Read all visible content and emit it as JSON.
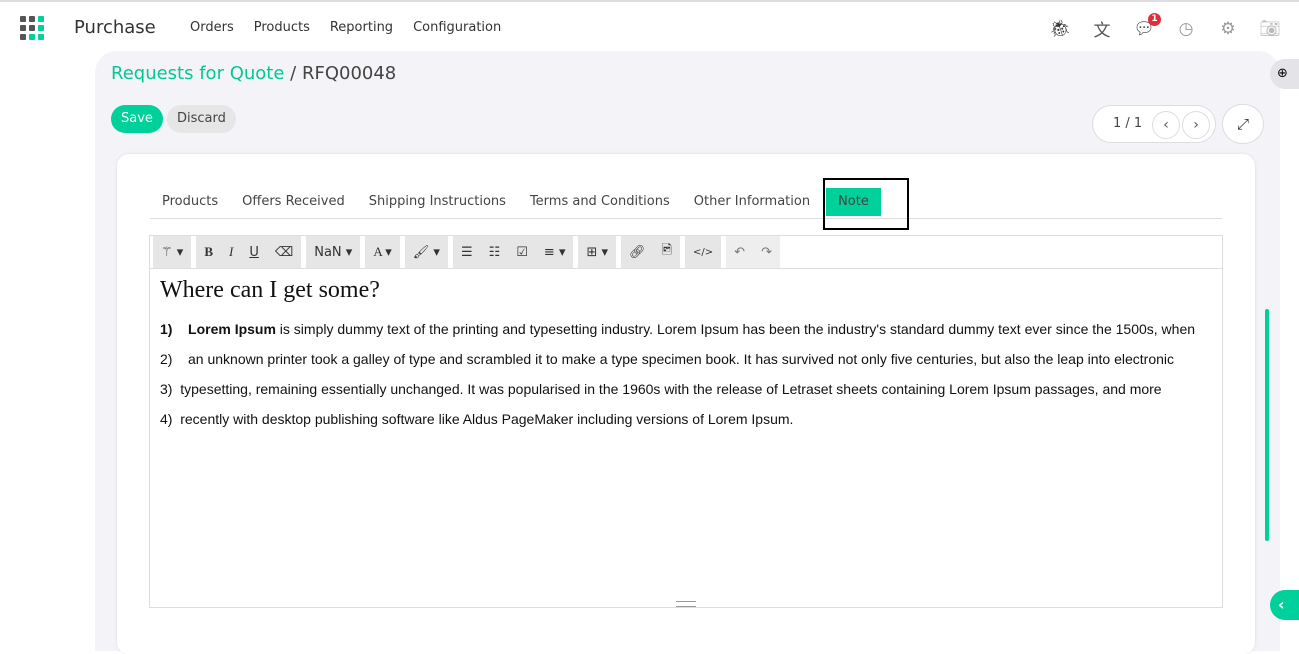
{
  "app": {
    "title": "Purchase",
    "menu": [
      "Orders",
      "Products",
      "Reporting",
      "Configuration"
    ],
    "notification_count": "1"
  },
  "icons": [
    "bug-icon",
    "translate-icon",
    "chat-icon",
    "clock-icon",
    "gear-icon",
    "camera-icon"
  ],
  "breadcrumb": {
    "parent": "Requests for Quote",
    "separator": "/",
    "current": "RFQ00048"
  },
  "actions": {
    "save": "Save",
    "discard": "Discard"
  },
  "pager": {
    "label": "1 / 1"
  },
  "tabs": [
    "Products",
    "Offers Received",
    "Shipping Instructions",
    "Terms and Conditions",
    "Other Information",
    "Note"
  ],
  "active_tab": "Note",
  "toolbar": {
    "font_size": "NaN"
  },
  "note": {
    "heading": "Where can I get some?",
    "lines": [
      {
        "num": "1)",
        "bold": "Lorem Ipsum",
        "text": " is simply dummy text of the printing and typesetting industry. Lorem Ipsum has been the industry's standard dummy text ever since the 1500s, when"
      },
      {
        "num": "2)",
        "text": "an unknown printer took a galley of type and scrambled it to make a type specimen book. It has survived not only five centuries, but also the leap into electronic"
      },
      {
        "num": "3)",
        "text": "typesetting, remaining essentially unchanged. It was popularised in the 1960s with the release of Letraset sheets containing Lorem Ipsum passages, and more"
      },
      {
        "num": "4)",
        "text": "recently with desktop publishing software like Aldus PageMaker including versions of Lorem Ipsum."
      }
    ]
  },
  "colors": {
    "accent": "#00d19a",
    "badge": "#e02e3b"
  }
}
